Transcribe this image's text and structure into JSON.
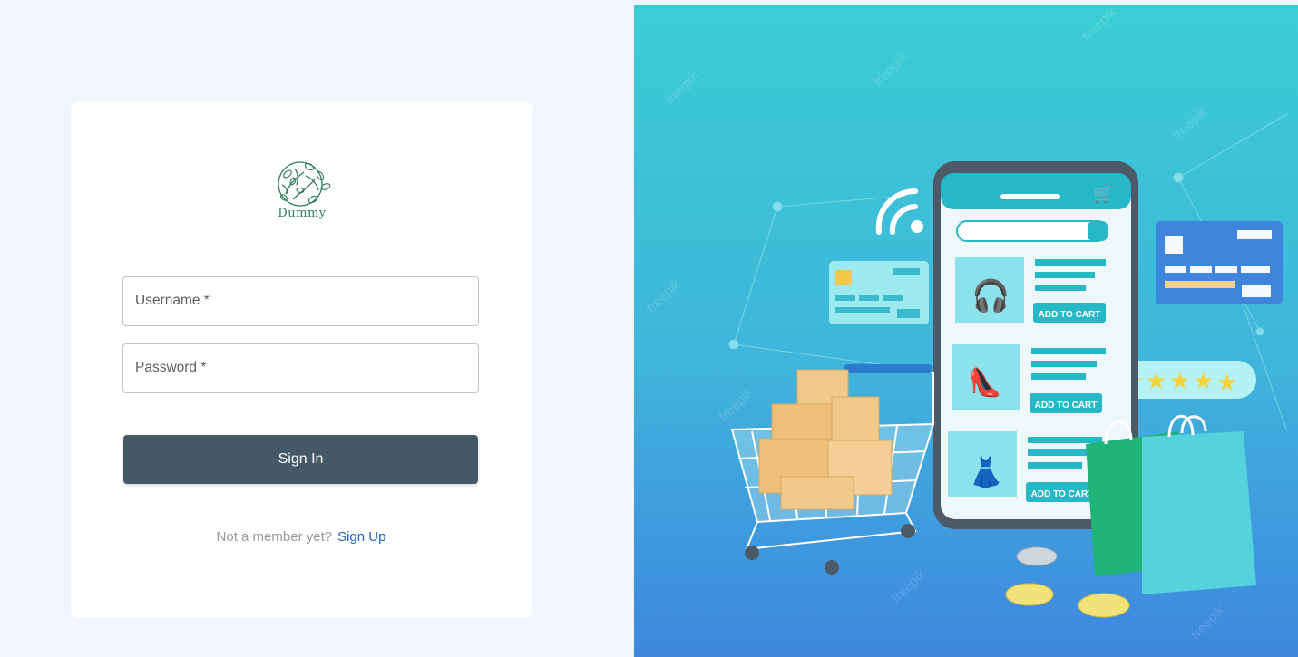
{
  "brand": {
    "logo_text": "Dummy"
  },
  "login_form": {
    "username_label": "Username *",
    "password_label": "Password *",
    "submit_label": "Sign In",
    "signup_prompt": "Not a member yet?",
    "signup_link": "Sign Up"
  },
  "illustration": {
    "add_to_cart_label": "ADD TO CART",
    "rating_stars": 5,
    "watermark": "freepik"
  },
  "colors": {
    "page_background": "#f1f6fe",
    "button": "#445866",
    "link": "#1f64b8",
    "logo": "#2f7a5b",
    "illustration_top": "#3ccdd3",
    "illustration_bottom": "#3f86df"
  }
}
